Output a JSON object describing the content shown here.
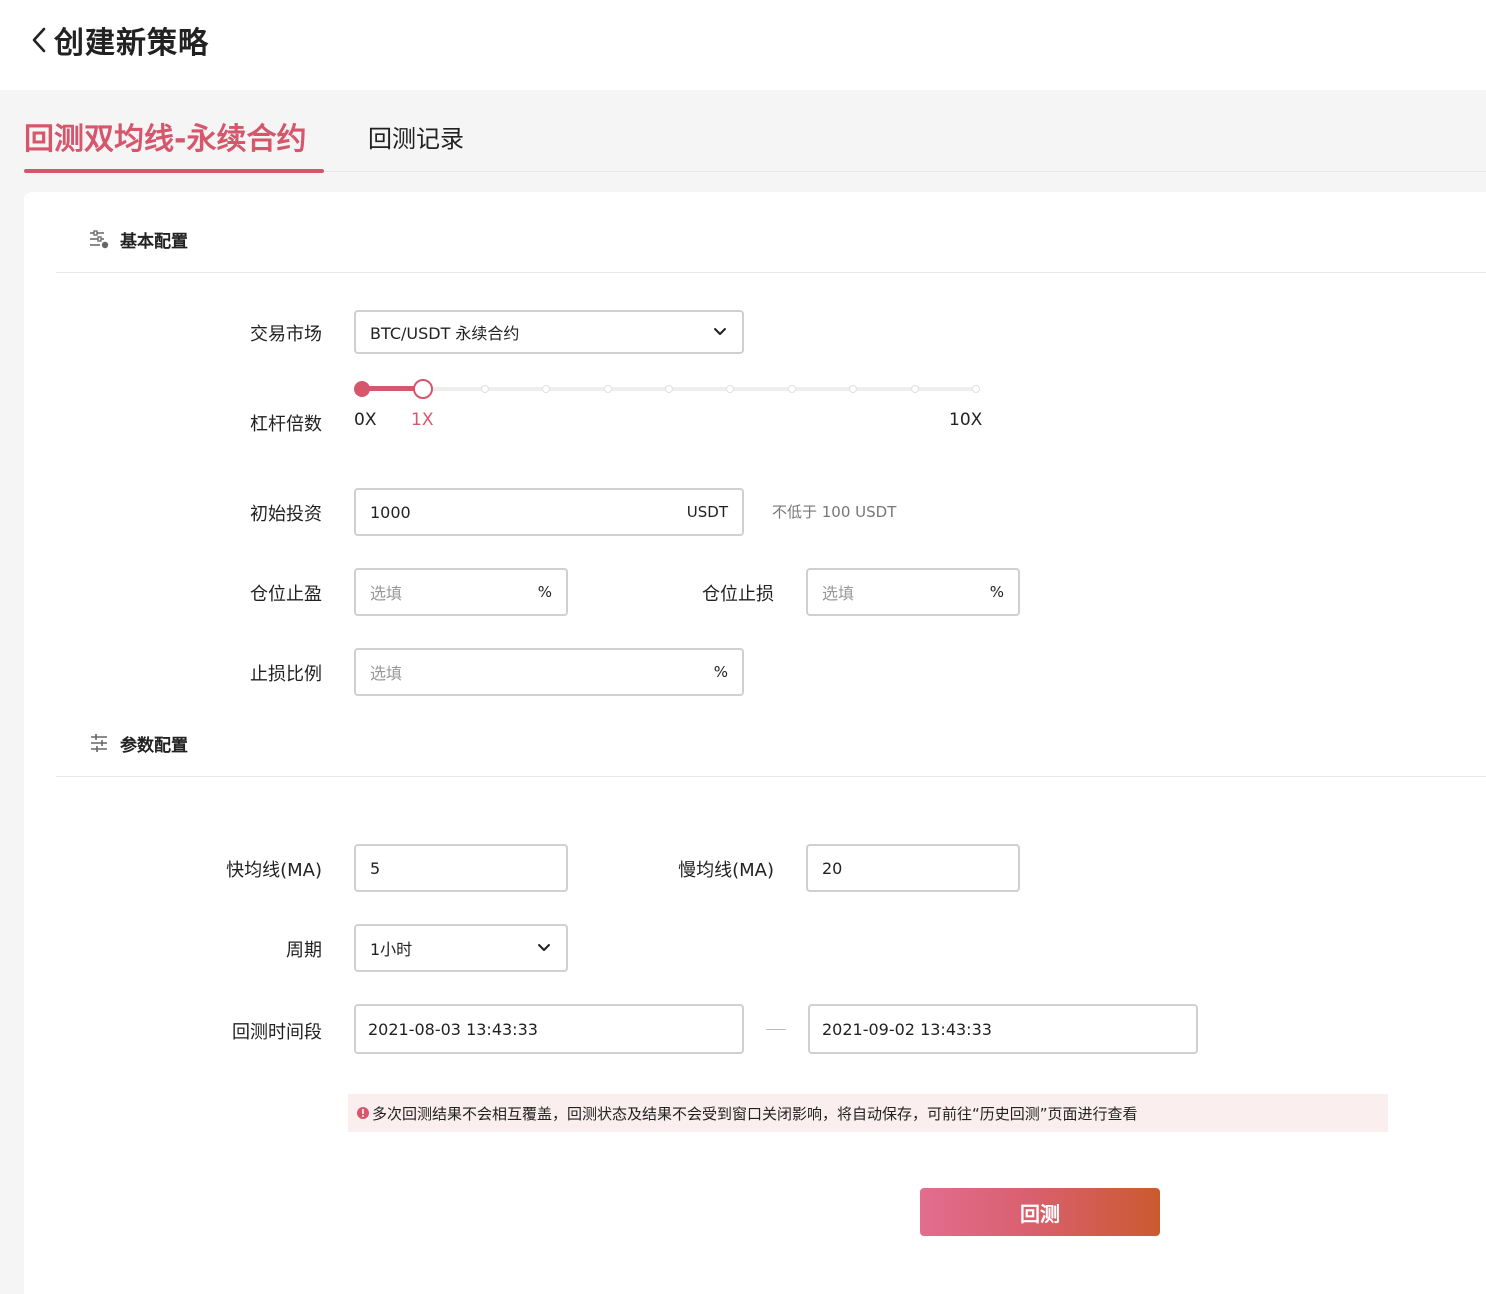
{
  "header": {
    "title": "创建新策略"
  },
  "tabs": [
    {
      "label": "回测双均线-永续合约",
      "active": true
    },
    {
      "label": "回测记录",
      "active": false
    }
  ],
  "basic": {
    "title": "基本配置",
    "market": {
      "label": "交易市场",
      "value": "BTC/USDT 永续合约"
    },
    "leverage": {
      "label": "杠杆倍数",
      "min_label": "0X",
      "current_label": "1X",
      "max_label": "10X",
      "min": 0,
      "max": 10,
      "value": 1
    },
    "investment": {
      "label": "初始投资",
      "value": "1000",
      "unit": "USDT",
      "hint": "不低于 100 USDT"
    },
    "take_profit": {
      "label": "仓位止盈",
      "placeholder": "选填",
      "unit": "%"
    },
    "stop_loss": {
      "label": "仓位止损",
      "placeholder": "选填",
      "unit": "%"
    },
    "stop_ratio": {
      "label": "止损比例",
      "placeholder": "选填",
      "unit": "%"
    }
  },
  "params": {
    "title": "参数配置",
    "fast_ma": {
      "label": "快均线(MA)",
      "value": "5"
    },
    "slow_ma": {
      "label": "慢均线(MA)",
      "value": "20"
    },
    "period": {
      "label": "周期",
      "value": "1小时"
    },
    "range": {
      "label": "回测时间段",
      "start": "2021-08-03 13:43:33",
      "end": "2021-09-02 13:43:33"
    }
  },
  "notice": {
    "text": "多次回测结果不会相互覆盖，回测状态及结果不会受到窗口关闭影响，将自动保存，可前往“历史回测”页面进行查看"
  },
  "actions": {
    "submit": "回测"
  },
  "colors": {
    "accent": "#d6566c",
    "notice_bg": "#fbeeee",
    "button_start": "#e26d8e",
    "button_end": "#cb5a30"
  }
}
